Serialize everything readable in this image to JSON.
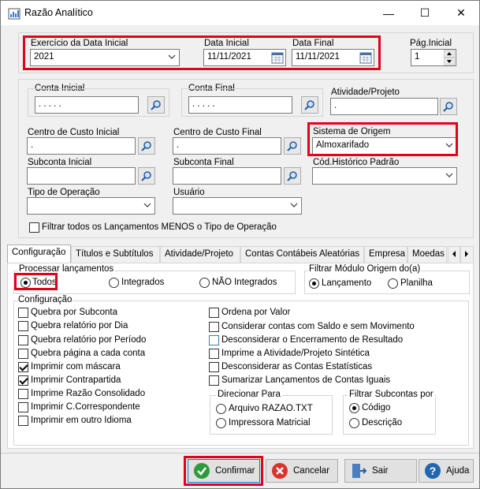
{
  "window": {
    "title": "Razão Analítico",
    "minimize": "—",
    "maximize": "☐",
    "close": "✕"
  },
  "top": {
    "exercicio_label": "Exercício da Data Inicial",
    "exercicio_value": "2021",
    "data_inicial_label": "Data Inicial",
    "data_inicial_value": "11/11/2021",
    "data_final_label": "Data Final",
    "data_final_value": "11/11/2021",
    "pag_inicial_label": "Pág.Inicial",
    "pag_inicial_value": "1"
  },
  "filters": {
    "conta_inicial_label": "Conta Inicial",
    "conta_inicial_value": ". . . . .",
    "conta_final_label": "Conta Final",
    "conta_final_value": ". . . . .",
    "atividade_label": "Atividade/Projeto",
    "atividade_value": ".",
    "centro_inicial_label": "Centro de Custo Inicial",
    "centro_inicial_value": ".",
    "centro_final_label": "Centro de Custo Final",
    "centro_final_value": ".",
    "sistema_label": "Sistema de Origem",
    "sistema_value": "Almoxarifado",
    "subconta_inicial_label": "Subconta Inicial",
    "subconta_final_label": "Subconta Final",
    "cod_historico_label": "Cód.Histórico Padrão",
    "tipo_operacao_label": "Tipo de Operação",
    "usuario_label": "Usuário",
    "filtrar_todos_label": "Filtrar todos os Lançamentos MENOS o Tipo de Operação"
  },
  "tabs": [
    {
      "label": "Configuração"
    },
    {
      "label": "Títulos e Subtítulos"
    },
    {
      "label": "Atividade/Projeto"
    },
    {
      "label": "Contas Contábeis Aleatórias"
    },
    {
      "label": "Empresa"
    },
    {
      "label": "Moedas"
    }
  ],
  "processar": {
    "label": "Processar lançamentos",
    "options": [
      {
        "label": "Todos",
        "selected": true
      },
      {
        "label": "Integrados",
        "selected": false
      },
      {
        "label": "NÃO Integrados",
        "selected": false
      }
    ]
  },
  "filtrar_modulo": {
    "label": "Filtrar Módulo Origem do(a)",
    "options": [
      {
        "label": "Lançamento",
        "selected": true
      },
      {
        "label": "Planilha",
        "selected": false
      }
    ]
  },
  "configuracao": {
    "label": "Configuração",
    "left": [
      {
        "label": "Quebra por Subconta",
        "checked": false
      },
      {
        "label": "Quebra relatório por Dia",
        "checked": false
      },
      {
        "label": "Quebra relatório por Período",
        "checked": false
      },
      {
        "label": "Quebra página a cada conta",
        "checked": false
      },
      {
        "label": "Imprimir com máscara",
        "checked": true
      },
      {
        "label": "Imprimir Contrapartida",
        "checked": true
      },
      {
        "label": "Imprime Razão Consolidado",
        "checked": false
      },
      {
        "label": "Imprimir C.Correspondente",
        "checked": false
      },
      {
        "label": "Imprimir em outro Idioma",
        "checked": false
      }
    ],
    "right": [
      {
        "label": "Ordena por Valor",
        "checked": false
      },
      {
        "label": "Considerar contas com Saldo e sem Movimento",
        "checked": false
      },
      {
        "label": "Desconsiderar o Encerramento de Resultado",
        "checked": false
      },
      {
        "label": "Imprime a Atividade/Projeto Sintética",
        "checked": false
      },
      {
        "label": "Desconsiderar as Contas Estatísticas",
        "checked": false
      },
      {
        "label": "Sumarizar Lançamentos de Contas Iguais",
        "checked": false
      }
    ]
  },
  "direcionar": {
    "label": "Direcionar  Para",
    "options": [
      {
        "label": "Arquivo RAZAO.TXT",
        "selected": false
      },
      {
        "label": "Impressora Matricial",
        "selected": false
      }
    ]
  },
  "filtrar_subcontas": {
    "label": "Filtrar Subcontas por",
    "options": [
      {
        "label": "Código",
        "selected": true
      },
      {
        "label": "Descrição",
        "selected": false
      }
    ]
  },
  "buttons": {
    "confirmar": "Confirmar",
    "cancelar": "Cancelar",
    "sair": "Sair",
    "ajuda": "Ajuda"
  },
  "colors": {
    "highlight": "#e3001b",
    "confirm_green": "#2e9a3e",
    "cancel_red": "#d9332b",
    "help_blue": "#2066b0"
  }
}
